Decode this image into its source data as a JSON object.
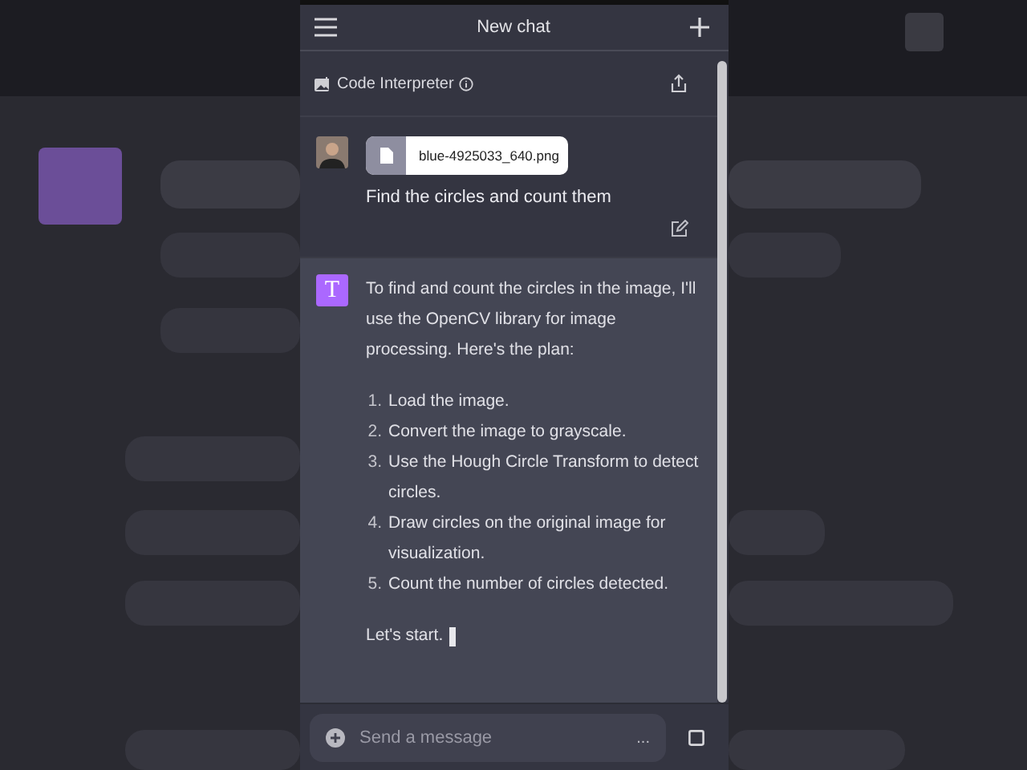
{
  "top_bar": {
    "title": "New chat"
  },
  "plugin_bar": {
    "label": "Code Interpreter"
  },
  "user_message": {
    "attachment": "blue-4925033_640.png",
    "text": "Find the circles and count them"
  },
  "assistant_message": {
    "avatar_letter": "T",
    "intro": "To find and count the circles in the image, I'll use the OpenCV library for image processing. Here's the plan:",
    "steps": [
      {
        "number": "1.",
        "text": "Load the image."
      },
      {
        "number": "2.",
        "text": "Convert the image to grayscale."
      },
      {
        "number": "3.",
        "text": "Use the Hough Circle Transform to detect circles."
      },
      {
        "number": "4.",
        "text": "Draw circles on the original image for visualization."
      },
      {
        "number": "5.",
        "text": "Count the number of circles detected."
      }
    ],
    "closing": "Let's start."
  },
  "composer": {
    "placeholder": "Send a message",
    "more": "..."
  }
}
